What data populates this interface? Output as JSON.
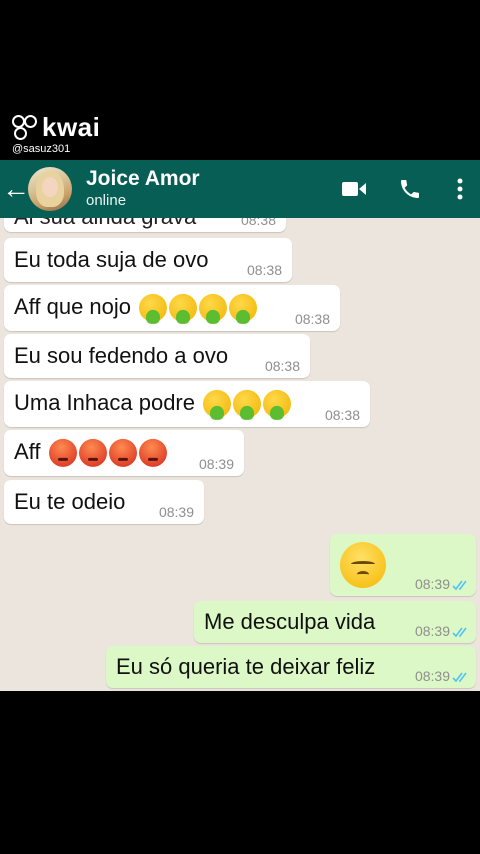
{
  "watermark": {
    "brand": "kwai",
    "handle": "@sasuz301"
  },
  "header": {
    "contact_name": "Joice Amor",
    "status": "online",
    "back_icon": "arrow-back-icon",
    "icons": [
      "video-call-icon",
      "phone-icon",
      "more-vert-icon"
    ],
    "color": "#075e54"
  },
  "messages": [
    {
      "dir": "in",
      "text": "Ai sua ainda grava",
      "time": "08:38",
      "partial": true
    },
    {
      "dir": "in",
      "text": "Eu toda suja de ovo",
      "time": "08:38"
    },
    {
      "dir": "in",
      "text": "Aff que nojo",
      "emoji": "nauseated-face x4",
      "time": "08:38"
    },
    {
      "dir": "in",
      "text": "Eu sou fedendo a ovo",
      "time": "08:38"
    },
    {
      "dir": "in",
      "text": "Uma Inhaca podre",
      "emoji": "nauseated-face x3",
      "time": "08:38"
    },
    {
      "dir": "in",
      "text": "Aff",
      "emoji": "angry-face x4",
      "time": "08:39"
    },
    {
      "dir": "in",
      "text": "Eu te odeio",
      "time": "08:39"
    },
    {
      "dir": "out",
      "text": "",
      "emoji": "pensive-face",
      "time": "08:39",
      "read": true
    },
    {
      "dir": "out",
      "text": "Me desculpa vida",
      "time": "08:39",
      "read": true
    },
    {
      "dir": "out",
      "text": "Eu só queria te deixar feliz",
      "time": "08:39",
      "read": true
    }
  ],
  "colors": {
    "incoming": "#ffffff",
    "outgoing": "#dcf8c6",
    "read_ticks": "#4fc3f7"
  }
}
